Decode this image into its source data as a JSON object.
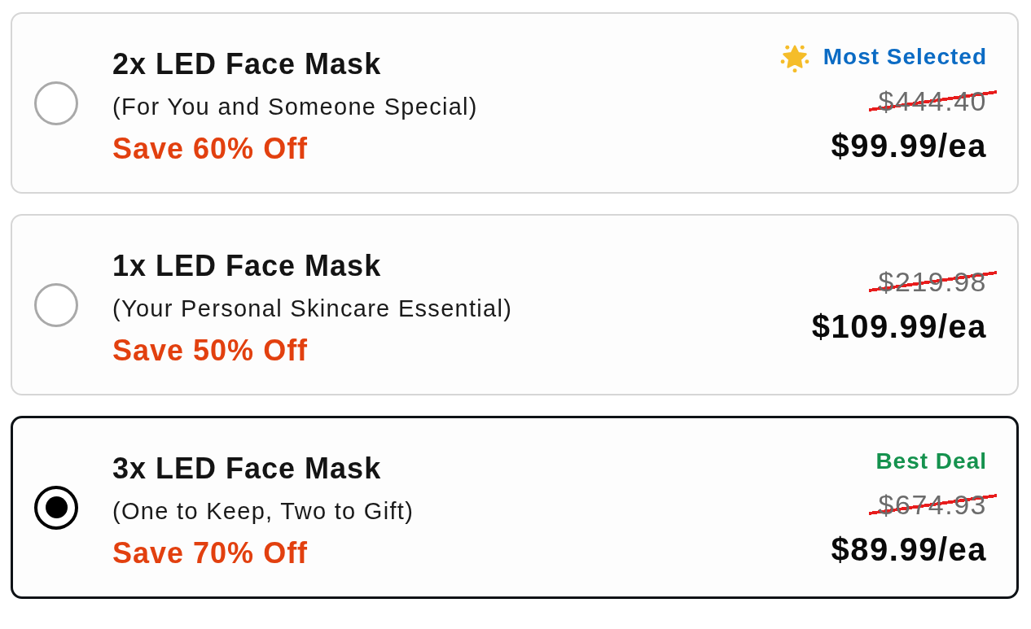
{
  "options": [
    {
      "title": "2x LED Face Mask",
      "subtitle": "(For You and Someone Special)",
      "savings": "Save 60% Off",
      "badge": {
        "kind": "popular",
        "text": "Most Selected"
      },
      "original_price": "$444.40",
      "price": "$99.99/ea",
      "selected": false
    },
    {
      "title": "1x LED Face Mask",
      "subtitle": "(Your Personal Skincare Essential)",
      "savings": "Save 50% Off",
      "original_price": "$219.98",
      "price": "$109.99/ea",
      "selected": false
    },
    {
      "title": "3x LED Face Mask",
      "subtitle": "(One to Keep, Two to Gift)",
      "savings": "Save 70% Off",
      "badge": {
        "kind": "deal",
        "text": "Best Deal"
      },
      "original_price": "$674.93",
      "price": "$89.99/ea",
      "selected": true
    }
  ]
}
